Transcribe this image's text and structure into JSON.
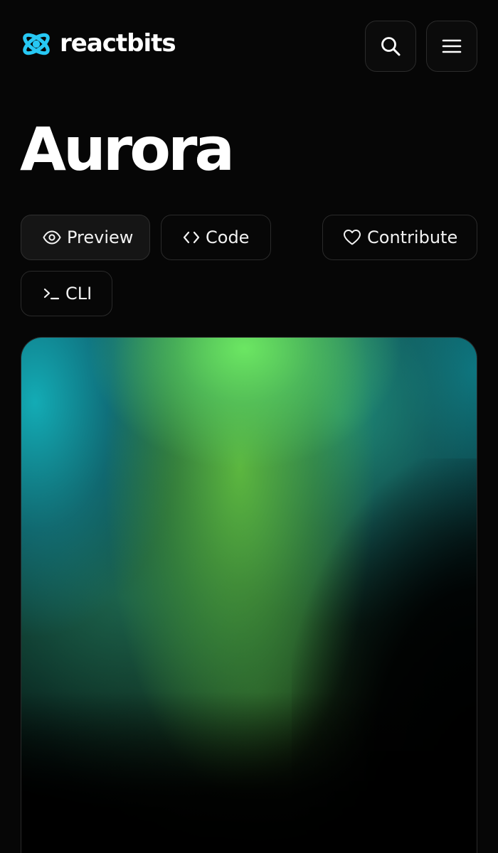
{
  "header": {
    "brand_name": "reactbits",
    "logo_icon": "reactbits-logo-icon",
    "search_icon": "search-icon",
    "menu_icon": "hamburger-menu-icon"
  },
  "page": {
    "title": "Aurora"
  },
  "tabs": [
    {
      "label": "Preview",
      "icon": "eye-icon",
      "active": true
    },
    {
      "label": "Code",
      "icon": "code-brackets-icon",
      "active": false
    },
    {
      "label": "Contribute",
      "icon": "heart-icon",
      "active": false
    },
    {
      "label": "CLI",
      "icon": "terminal-icon",
      "active": false
    }
  ],
  "colors": {
    "background": "#060606",
    "border": "#2a2a2a",
    "brand_accent": "#27c8f4",
    "aurora_green": "#6ee864",
    "aurora_teal": "#14b4be",
    "aurora_dark_teal": "#0a7d8c"
  }
}
